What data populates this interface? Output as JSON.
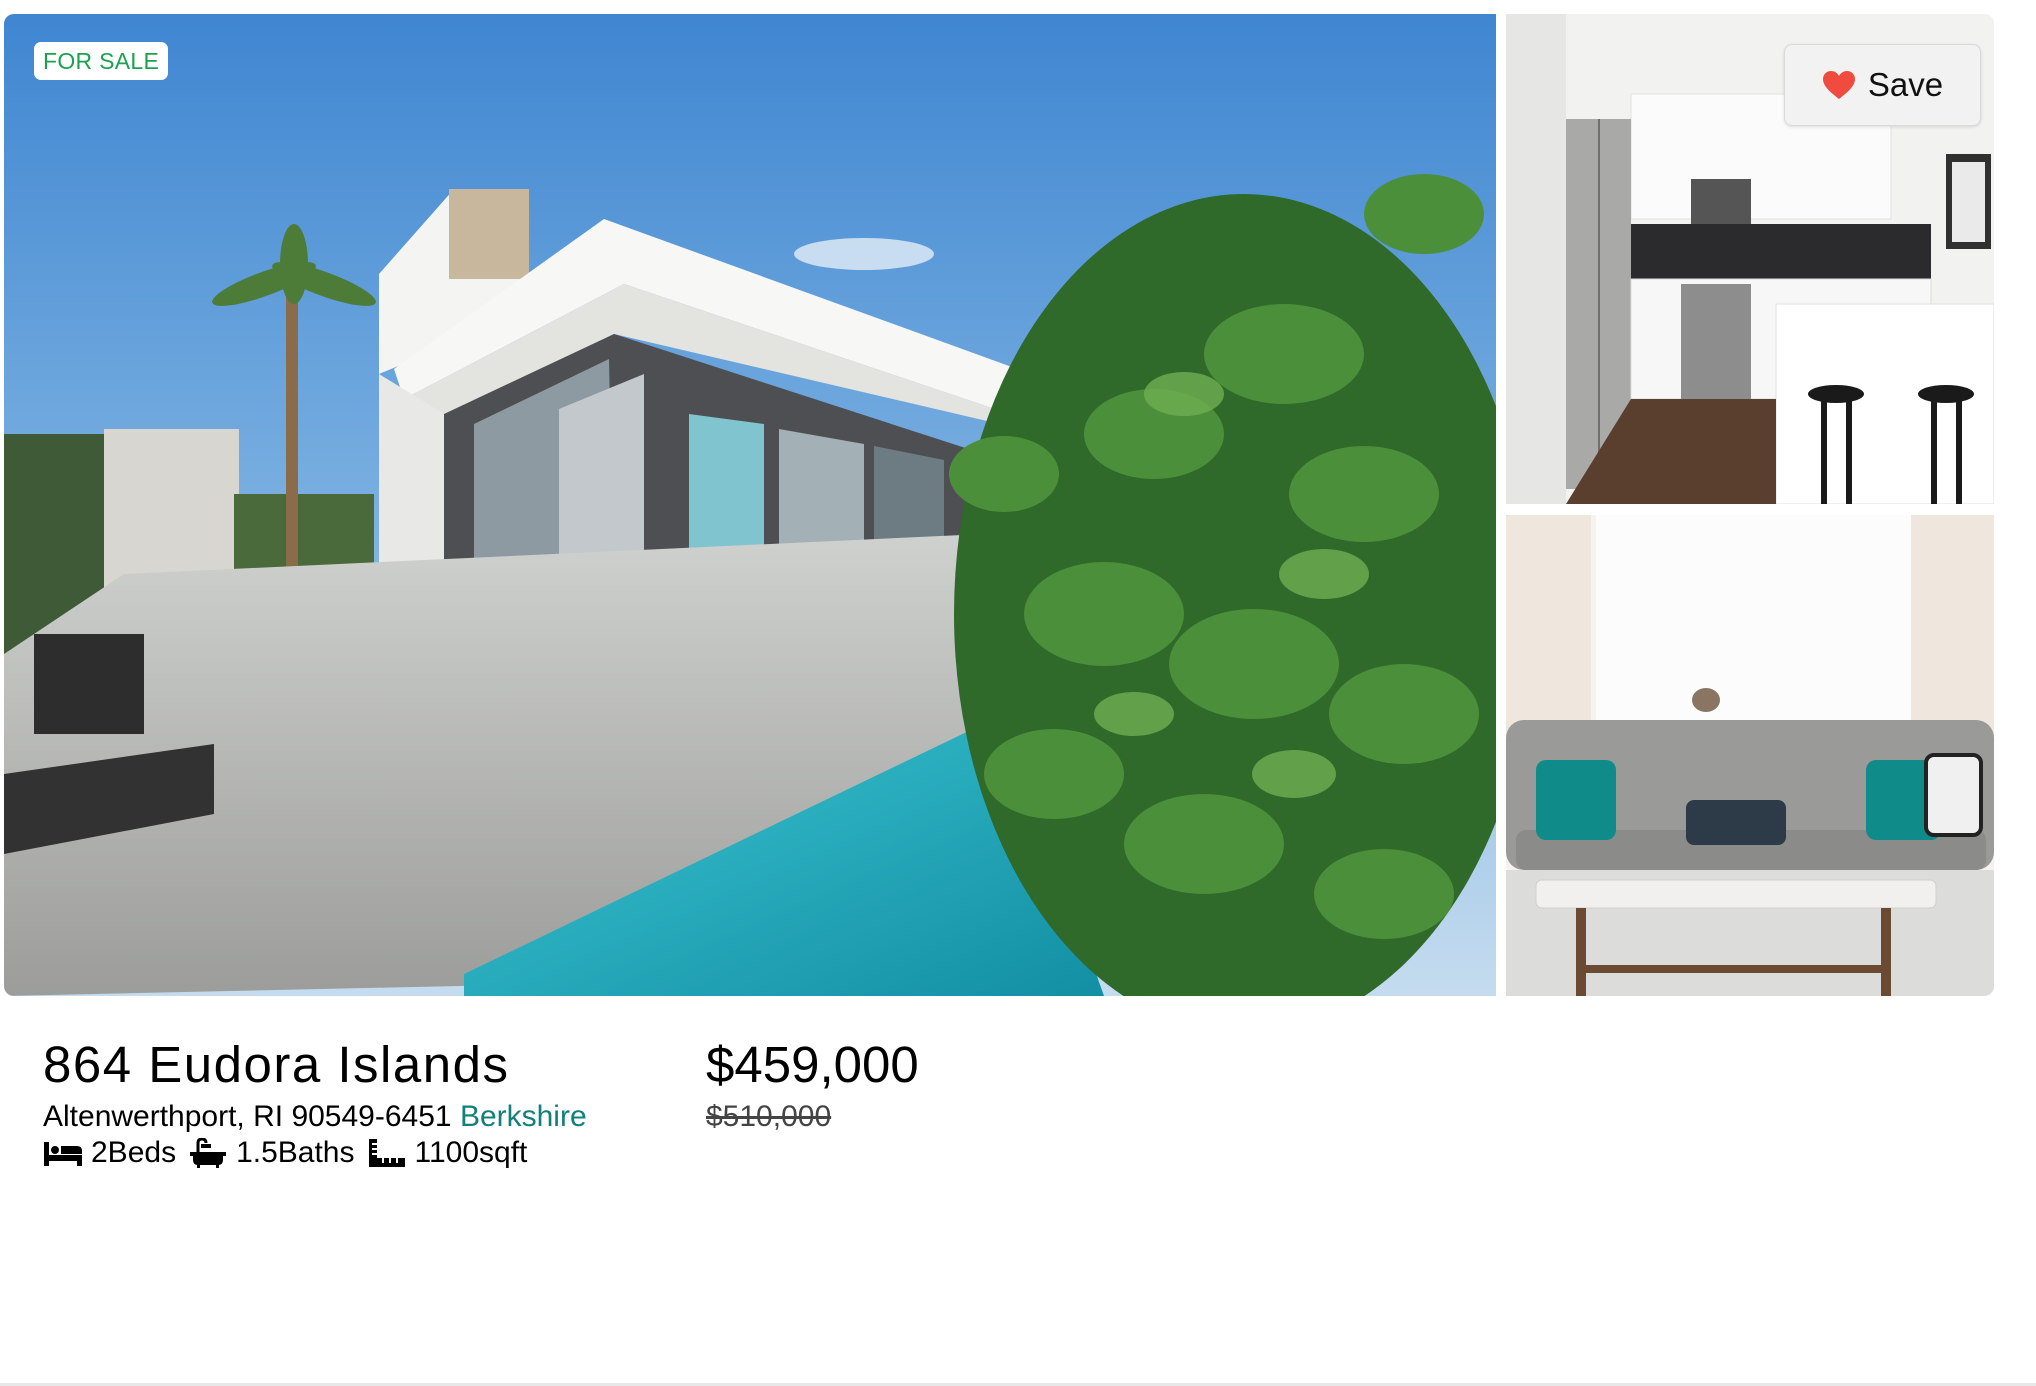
{
  "listing": {
    "status_badge": "FOR SALE",
    "save_label": "Save",
    "address": {
      "street": "864 Eudora Islands",
      "city_state_zip": "Altenwerthport, RI 90549-6451",
      "brokerage": "Berkshire"
    },
    "price": "$459,000",
    "original_price": "$510,000",
    "specs": {
      "beds": "2Beds",
      "baths": "1.5Baths",
      "area": "1100sqft"
    },
    "photos": [
      {
        "subject": "modern white villa with pool and palm trees"
      },
      {
        "subject": "kitchen with stainless steel appliances and bar stools"
      },
      {
        "subject": "living room with grey tufted sofa and coffee table"
      }
    ]
  },
  "icons": {
    "save": "heart-icon",
    "beds": "bed-icon",
    "baths": "bath-icon",
    "area": "ruler-icon"
  },
  "colors": {
    "badge_text": "#1aa251",
    "brokerage_link": "#12807a",
    "heart": "#ef4b3f"
  }
}
